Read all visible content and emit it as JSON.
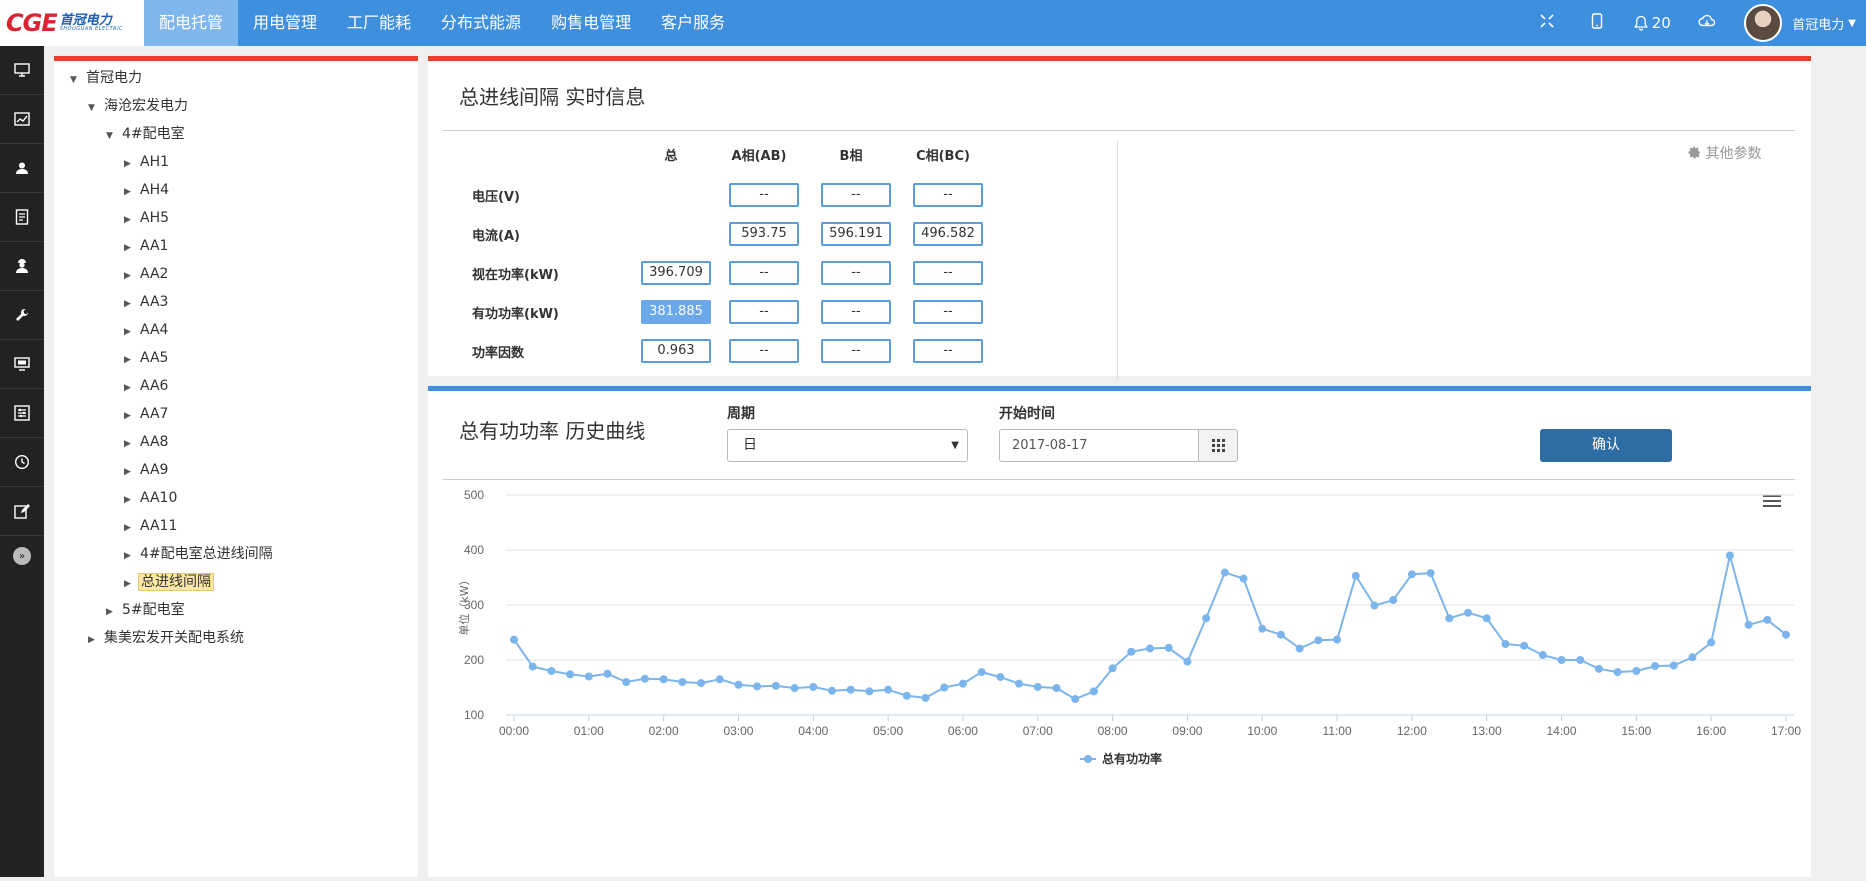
{
  "topbar": {
    "logo_mark": "CGE",
    "logo_text": "首冠电力",
    "logo_sub": "SHOUGUAN ELECTRIC",
    "nav": [
      {
        "label": "配电托管",
        "active": true
      },
      {
        "label": "用电管理",
        "active": false
      },
      {
        "label": "工厂能耗",
        "active": false
      },
      {
        "label": "分布式能源",
        "active": false
      },
      {
        "label": "购售电管理",
        "active": false
      },
      {
        "label": "客户服务",
        "active": false
      }
    ],
    "notification_count": "20",
    "user_name": "首冠电力"
  },
  "tree": [
    {
      "label": "首冠电力",
      "level": 0,
      "expanded": true
    },
    {
      "label": "海沧宏发电力",
      "level": 1,
      "expanded": true
    },
    {
      "label": "4#配电室",
      "level": 2,
      "expanded": true
    },
    {
      "label": "AH1",
      "level": 3,
      "expanded": false
    },
    {
      "label": "AH4",
      "level": 3,
      "expanded": false
    },
    {
      "label": "AH5",
      "level": 3,
      "expanded": false
    },
    {
      "label": "AA1",
      "level": 3,
      "expanded": false
    },
    {
      "label": "AA2",
      "level": 3,
      "expanded": false
    },
    {
      "label": "AA3",
      "level": 3,
      "expanded": false
    },
    {
      "label": "AA4",
      "level": 3,
      "expanded": false
    },
    {
      "label": "AA5",
      "level": 3,
      "expanded": false
    },
    {
      "label": "AA6",
      "level": 3,
      "expanded": false
    },
    {
      "label": "AA7",
      "level": 3,
      "expanded": false
    },
    {
      "label": "AA8",
      "level": 3,
      "expanded": false
    },
    {
      "label": "AA9",
      "level": 3,
      "expanded": false
    },
    {
      "label": "AA10",
      "level": 3,
      "expanded": false
    },
    {
      "label": "AA11",
      "level": 3,
      "expanded": false
    },
    {
      "label": "4#配电室总进线间隔",
      "level": 3,
      "expanded": false
    },
    {
      "label": "总进线间隔",
      "level": 3,
      "expanded": false,
      "selected": true
    },
    {
      "label": "5#配电室",
      "level": 2,
      "expanded": false
    },
    {
      "label": "集美宏发开关配电系统",
      "level": 1,
      "expanded": false
    }
  ],
  "realtime": {
    "title": "总进线间隔 实时信息",
    "other_params": "其他参数",
    "columns": [
      "总",
      "A相(AB)",
      "B相",
      "C相(BC)"
    ],
    "rows": [
      {
        "label": "电压(V)",
        "values": [
          "",
          "--",
          "--",
          "--"
        ]
      },
      {
        "label": "电流(A)",
        "values": [
          "",
          "593.75",
          "596.191",
          "496.582"
        ]
      },
      {
        "label": "视在功率(kW)",
        "values": [
          "396.709",
          "--",
          "--",
          "--"
        ]
      },
      {
        "label": "有功功率(kW)",
        "values": [
          "381.885",
          "--",
          "--",
          "--"
        ]
      },
      {
        "label": "功率因数",
        "values": [
          "0.963",
          "--",
          "--",
          "--"
        ]
      }
    ]
  },
  "history": {
    "title": "总有功功率 历史曲线",
    "period_label": "周期",
    "period_value": "日",
    "start_label": "开始时间",
    "start_value": "2017-08-17",
    "confirm_label": "确认"
  },
  "chart_data": {
    "type": "line",
    "title": "",
    "xlabel": "",
    "ylabel": "单位（kW）",
    "ylim": [
      100,
      500
    ],
    "yticks": [
      100,
      200,
      300,
      400,
      500
    ],
    "x_tick_labels": [
      "00:00",
      "01:00",
      "02:00",
      "03:00",
      "04:00",
      "05:00",
      "06:00",
      "07:00",
      "08:00",
      "09:00",
      "10:00",
      "11:00",
      "12:00",
      "13:00",
      "14:00",
      "15:00",
      "16:00",
      "17:00"
    ],
    "x_interval_minutes": 15,
    "color": "#7cb5ec",
    "grid": true,
    "legend_position": "bottom-center",
    "series": [
      {
        "name": "总有功功率",
        "values": [
          237,
          188,
          180,
          174,
          170,
          175,
          160,
          166,
          165,
          160,
          158,
          165,
          155,
          152,
          153,
          149,
          151,
          144,
          146,
          143,
          146,
          135,
          131,
          150,
          157,
          178,
          169,
          157,
          151,
          149,
          129,
          143,
          185,
          215,
          221,
          222,
          197,
          276,
          359,
          348,
          257,
          246,
          221,
          236,
          237,
          353,
          299,
          309,
          356,
          358,
          276,
          286,
          276,
          229,
          226,
          209,
          200,
          200,
          184,
          178,
          180,
          189,
          190,
          205,
          232,
          390,
          264,
          273,
          246
        ]
      }
    ]
  }
}
